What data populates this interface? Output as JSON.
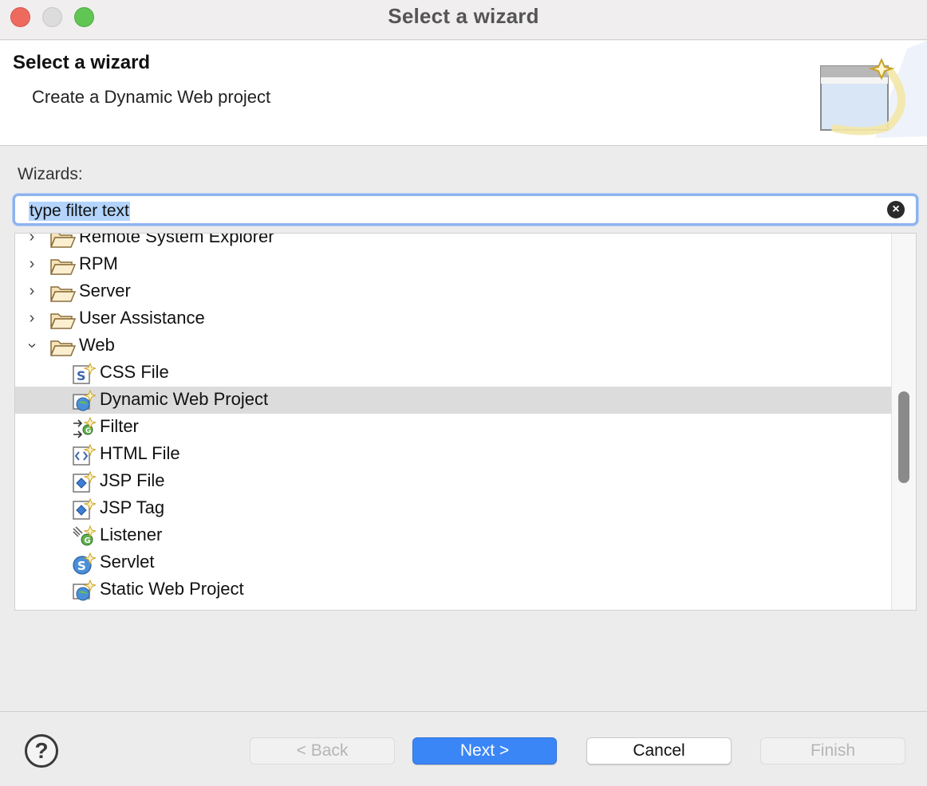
{
  "window": {
    "title": "Select a wizard"
  },
  "banner": {
    "title": "Select a wizard",
    "description": "Create a Dynamic Web project"
  },
  "wizards_label": "Wizards:",
  "filter": {
    "value": "type filter text",
    "clear_icon": "clear-icon"
  },
  "tree": {
    "items": [
      {
        "label": "Remote System Explorer",
        "type": "category",
        "expanded": false
      },
      {
        "label": "RPM",
        "type": "category",
        "expanded": false
      },
      {
        "label": "Server",
        "type": "category",
        "expanded": false
      },
      {
        "label": "User Assistance",
        "type": "category",
        "expanded": false
      },
      {
        "label": "Web",
        "type": "category",
        "expanded": true
      },
      {
        "label": "CSS File",
        "type": "wizard",
        "icon": "css-file-icon"
      },
      {
        "label": "Dynamic Web Project",
        "type": "wizard",
        "icon": "dynamic-web-project-icon",
        "selected": true
      },
      {
        "label": "Filter",
        "type": "wizard",
        "icon": "filter-icon"
      },
      {
        "label": "HTML File",
        "type": "wizard",
        "icon": "html-file-icon"
      },
      {
        "label": "JSP File",
        "type": "wizard",
        "icon": "jsp-file-icon"
      },
      {
        "label": "JSP Tag",
        "type": "wizard",
        "icon": "jsp-tag-icon"
      },
      {
        "label": "Listener",
        "type": "wizard",
        "icon": "listener-icon"
      },
      {
        "label": "Servlet",
        "type": "wizard",
        "icon": "servlet-icon"
      },
      {
        "label": "Static Web Project",
        "type": "wizard",
        "icon": "static-web-project-icon"
      }
    ]
  },
  "buttons": {
    "help": "?",
    "back": "< Back",
    "next": "Next >",
    "cancel": "Cancel",
    "finish": "Finish"
  },
  "colors": {
    "accent": "#3b86f6",
    "selection": "#dcdcdc",
    "filter_highlight": "#b3d4fc"
  }
}
